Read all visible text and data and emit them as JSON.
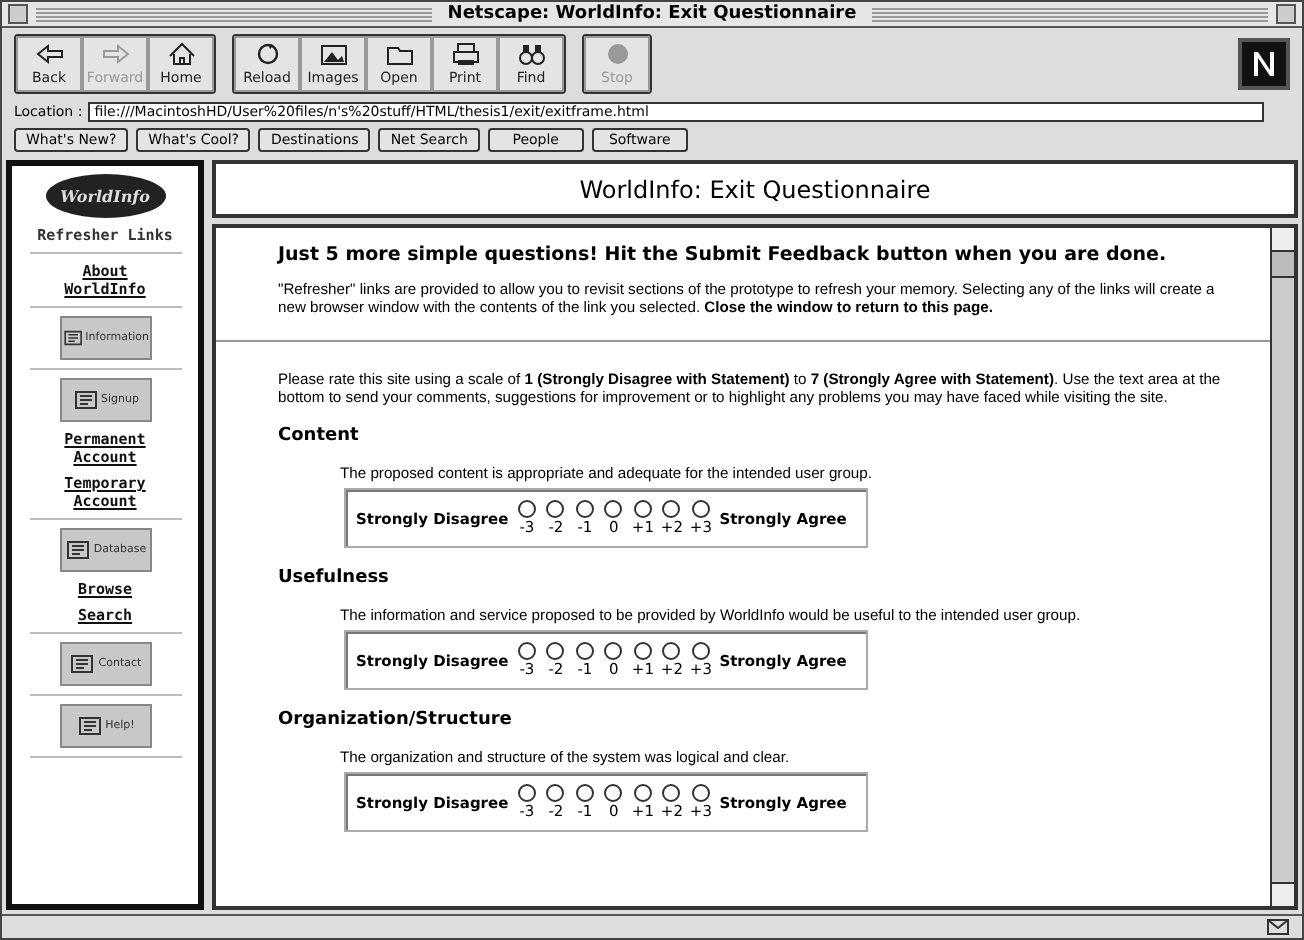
{
  "window": {
    "title": "Netscape: WorldInfo: Exit Questionnaire"
  },
  "toolbar": [
    [
      {
        "label": "Back",
        "disabled": false
      },
      {
        "label": "Forward",
        "disabled": true
      },
      {
        "label": "Home",
        "disabled": false
      }
    ],
    [
      {
        "label": "Reload",
        "disabled": false
      },
      {
        "label": "Images",
        "disabled": false
      },
      {
        "label": "Open",
        "disabled": false
      },
      {
        "label": "Print",
        "disabled": false
      },
      {
        "label": "Find",
        "disabled": false
      }
    ],
    [
      {
        "label": "Stop",
        "disabled": true
      }
    ]
  ],
  "location": {
    "label": "Location :",
    "value": "file:///MacintoshHD/User%20files/n's%20stuff/HTML/thesis1/exit/exitframe.html"
  },
  "directory_buttons": [
    "What's New?",
    "What's Cool?",
    "Destinations",
    "Net Search",
    "People",
    "Software"
  ],
  "sidebar": {
    "logo": "WorldInfo",
    "sections": [
      [
        {
          "kind": "heading",
          "label": "Refresher Links"
        }
      ],
      [
        {
          "kind": "link",
          "label": "About WorldInfo"
        }
      ],
      [
        {
          "kind": "image-button",
          "label": "Information"
        }
      ],
      [
        {
          "kind": "image-button",
          "label": "Signup"
        },
        {
          "kind": "link",
          "label": "Permanent Account"
        },
        {
          "kind": "link",
          "label": "Temporary Account"
        }
      ],
      [
        {
          "kind": "image-button",
          "label": "Database"
        },
        {
          "kind": "link",
          "label": "Browse"
        },
        {
          "kind": "link",
          "label": "Search"
        }
      ],
      [
        {
          "kind": "image-button",
          "label": "Contact"
        }
      ],
      [
        {
          "kind": "image-button",
          "label": "Help!"
        }
      ]
    ]
  },
  "page_title": "WorldInfo: Exit Questionnaire",
  "content": {
    "heading": "Just 5 more simple questions! Hit the Submit Feedback button when you are done.",
    "intro": "\"Refresher\" links are provided to allow you to revisit sections of the prototype to refresh your memory. Selecting any of the links will create a new browser window with the contents of the link you selected. **Close the window to return to this page.**",
    "instructions": "Please rate this site using a scale of **1 (Strongly Disagree with Statement)** to **7 (Strongly Agree with Statement)**. Use the text area at the bottom to send your comments, suggestions for improvement or to highlight any problems you may have faced while visiting the site.",
    "questions": [
      {
        "title": "Content",
        "statement": "The proposed content is appropriate and adequate for the intended user group.",
        "low": "Strongly Disagree",
        "high": "Strongly Agree",
        "options": [
          {
            "label": "-3",
            "selected": false
          },
          {
            "label": "-2",
            "selected": false
          },
          {
            "label": "-1",
            "selected": false
          },
          {
            "label": "0",
            "selected": false
          },
          {
            "label": "+1",
            "selected": false
          },
          {
            "label": "+2",
            "selected": false
          },
          {
            "label": "+3",
            "selected": false
          }
        ]
      },
      {
        "title": "Usefulness",
        "statement": "The information and service proposed to be provided by WorldInfo would be useful to the intended user group.",
        "low": "Strongly Disagree",
        "high": "Strongly Agree",
        "options": [
          {
            "label": "-3",
            "selected": false
          },
          {
            "label": "-2",
            "selected": false
          },
          {
            "label": "-1",
            "selected": false
          },
          {
            "label": "0",
            "selected": false
          },
          {
            "label": "+1",
            "selected": false
          },
          {
            "label": "+2",
            "selected": false
          },
          {
            "label": "+3",
            "selected": false
          }
        ]
      },
      {
        "title": "Organization/Structure",
        "statement": "The organization and structure of the system was logical and clear.",
        "low": "Strongly Disagree",
        "high": "Strongly Agree",
        "options": [
          {
            "label": "-3",
            "selected": false
          },
          {
            "label": "-2",
            "selected": false
          },
          {
            "label": "-1",
            "selected": false
          },
          {
            "label": "0",
            "selected": false
          },
          {
            "label": "+1",
            "selected": false
          },
          {
            "label": "+2",
            "selected": false
          },
          {
            "label": "+3",
            "selected": false
          }
        ]
      }
    ]
  }
}
